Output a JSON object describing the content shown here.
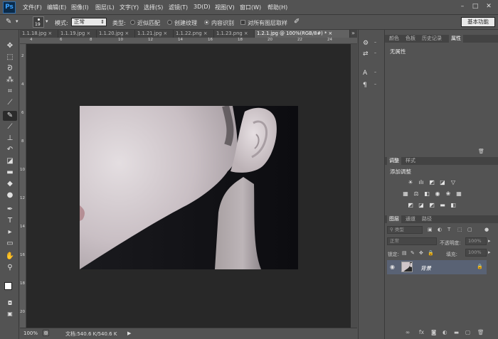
{
  "app": {
    "logo": "Ps"
  },
  "menubar": {
    "items": [
      "文件(F)",
      "编辑(E)",
      "图像(I)",
      "图层(L)",
      "文字(Y)",
      "选择(S)",
      "滤镜(T)",
      "3D(D)",
      "视图(V)",
      "窗口(W)",
      "帮助(H)"
    ],
    "window_controls": {
      "minimize": "–",
      "restore": "□",
      "close": "✕"
    }
  },
  "options": {
    "brush_size": "19",
    "mode_label": "模式:",
    "mode_value": "正常",
    "type_label": "类型:",
    "type_options": [
      "近似匹配",
      "创建纹理",
      "内容识别"
    ],
    "type_selected": 2,
    "sample_all_label": "对所有图层取样",
    "workspace": "基本功能"
  },
  "tabs": [
    {
      "label": "1.1.18.jpg",
      "close": "×"
    },
    {
      "label": "1.1.19.jpg",
      "close": "×"
    },
    {
      "label": "1.1.20.jpg",
      "close": "×"
    },
    {
      "label": "1.1.21.jpg",
      "close": "×"
    },
    {
      "label": "1.1.22.png",
      "close": "×"
    },
    {
      "label": "1.1.23.png",
      "close": "×"
    },
    {
      "label": "1.2.1.jpg @ 100%(RGB/8#) *",
      "close": "×"
    }
  ],
  "tabs_overflow": "»",
  "rulers": {
    "h": [
      "4",
      "6",
      "8",
      "10",
      "12",
      "14",
      "16",
      "18",
      "20",
      "22",
      "24"
    ],
    "v": [
      "2",
      "4",
      "6",
      "8",
      "10",
      "12",
      "14",
      "16",
      "18",
      "20"
    ]
  },
  "status": {
    "zoom": "100%",
    "doc": "文档:540.6 K/540.6 K",
    "arrow": "▶"
  },
  "panels": {
    "props": {
      "tabs": [
        "颜色",
        "色板",
        "历史记录",
        "属性"
      ],
      "active": 3,
      "body": "无属性"
    },
    "adjust": {
      "tabs": [
        "调整",
        "样式"
      ],
      "active": 0,
      "title": "添加调整"
    },
    "layers": {
      "tabs": [
        "图层",
        "通道",
        "路径"
      ],
      "active": 0,
      "filter_kind": "类型",
      "blend_mode": "正常",
      "opacity_label": "不透明度:",
      "opacity_value": "100%",
      "lock_label": "锁定:",
      "fill_label": "填充:",
      "fill_value": "100%",
      "layer_name": "背景"
    }
  }
}
